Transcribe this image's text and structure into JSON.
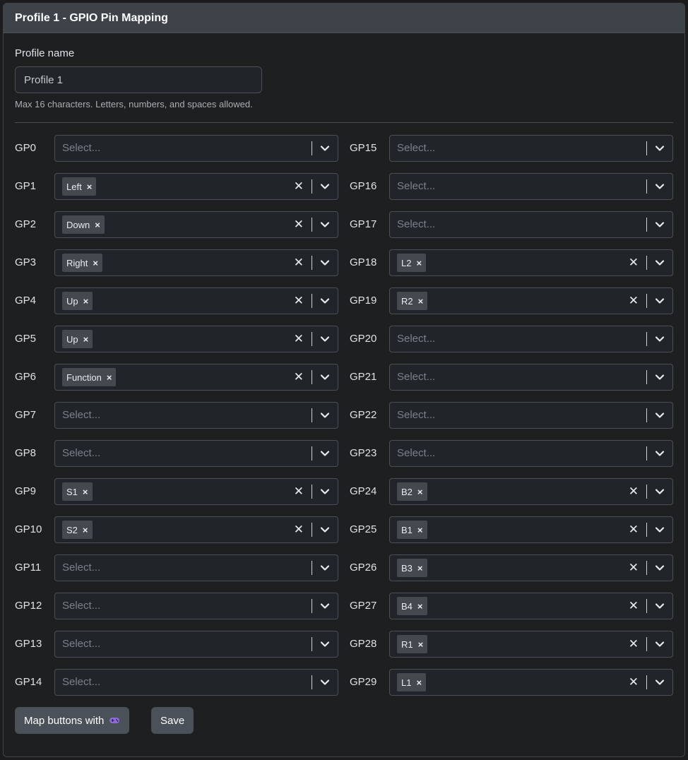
{
  "card": {
    "title": "Profile 1 - GPIO Pin Mapping"
  },
  "profile": {
    "label": "Profile name",
    "value": "Profile 1",
    "help": "Max 16 characters. Letters, numbers, and spaces allowed."
  },
  "placeholder": "Select...",
  "pins_left": [
    {
      "pin": "GP0",
      "value": ""
    },
    {
      "pin": "GP1",
      "value": "Left"
    },
    {
      "pin": "GP2",
      "value": "Down"
    },
    {
      "pin": "GP3",
      "value": "Right"
    },
    {
      "pin": "GP4",
      "value": "Up"
    },
    {
      "pin": "GP5",
      "value": "Up"
    },
    {
      "pin": "GP6",
      "value": "Function"
    },
    {
      "pin": "GP7",
      "value": ""
    },
    {
      "pin": "GP8",
      "value": ""
    },
    {
      "pin": "GP9",
      "value": "S1"
    },
    {
      "pin": "GP10",
      "value": "S2"
    },
    {
      "pin": "GP11",
      "value": ""
    },
    {
      "pin": "GP12",
      "value": ""
    },
    {
      "pin": "GP13",
      "value": ""
    },
    {
      "pin": "GP14",
      "value": ""
    }
  ],
  "pins_right": [
    {
      "pin": "GP15",
      "value": ""
    },
    {
      "pin": "GP16",
      "value": ""
    },
    {
      "pin": "GP17",
      "value": ""
    },
    {
      "pin": "GP18",
      "value": "L2"
    },
    {
      "pin": "GP19",
      "value": "R2"
    },
    {
      "pin": "GP20",
      "value": ""
    },
    {
      "pin": "GP21",
      "value": ""
    },
    {
      "pin": "GP22",
      "value": ""
    },
    {
      "pin": "GP23",
      "value": ""
    },
    {
      "pin": "GP24",
      "value": "B2"
    },
    {
      "pin": "GP25",
      "value": "B1"
    },
    {
      "pin": "GP26",
      "value": "B3"
    },
    {
      "pin": "GP27",
      "value": "B4"
    },
    {
      "pin": "GP28",
      "value": "R1"
    },
    {
      "pin": "GP29",
      "value": "L1"
    }
  ],
  "buttons": {
    "map_label": "Map buttons with",
    "map_icon": "gamepad-icon",
    "save_label": "Save"
  },
  "colors": {
    "header_bg": "#3d4349",
    "chip_bg": "#43494f",
    "icon_accent": "#8e6bd8"
  }
}
